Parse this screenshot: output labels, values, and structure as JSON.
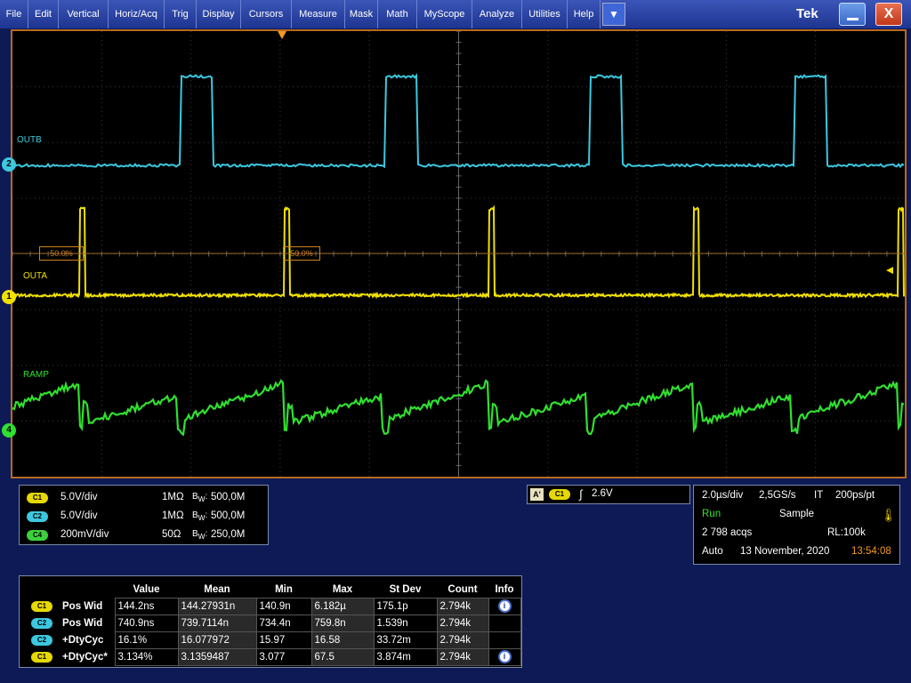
{
  "menubar": {
    "items": [
      "File",
      "Edit",
      "Vertical",
      "Horiz/Acq",
      "Trig",
      "Display",
      "Cursors",
      "Measure",
      "Mask",
      "Math",
      "MyScope",
      "Analyze",
      "Utilities",
      "Help"
    ],
    "dropdown_glyph": "▼",
    "brand": "Tek",
    "close_glyph": "X"
  },
  "waveforms": {
    "ch2": {
      "label": "OUTB",
      "marker": "2",
      "color": "#3cc8e0"
    },
    "ch1": {
      "label": "OUTA",
      "marker": "1",
      "color": "#f0e000"
    },
    "ch4": {
      "label": "RAMP",
      "marker": "4",
      "color": "#30e030"
    },
    "cursor_left_label": "50.0%",
    "cursor_right_label": "50.0%"
  },
  "channels": [
    {
      "tag": "C1",
      "scale": "5.0V/div",
      "impedance": "1MΩ",
      "bw": "500,0M",
      "color": "c1"
    },
    {
      "tag": "C2",
      "scale": "5.0V/div",
      "impedance": "1MΩ",
      "bw": "500,0M",
      "color": "c2"
    },
    {
      "tag": "C4",
      "scale": "200mV/div",
      "impedance": "50Ω",
      "bw": "250,0M",
      "color": "c4"
    }
  ],
  "trigger": {
    "mode_tag": "A'",
    "source": "C1",
    "level": "2.6V"
  },
  "acquisition": {
    "timebase": "2.0µs/div",
    "sample_rate": "2,5GS/s",
    "mode_code": "IT",
    "resolution": "200ps/pt",
    "state": "Run",
    "sample_mode": "Sample",
    "acqs": "2 798 acqs",
    "record_length": "RL:100k",
    "trigger_mode": "Auto",
    "date": "13 November, 2020",
    "time": "13:54:08",
    "colors": {
      "run": "#30e030",
      "time": "#f09a20"
    }
  },
  "measurements": {
    "headers": [
      "Value",
      "Mean",
      "Min",
      "Max",
      "St Dev",
      "Count",
      "Info"
    ],
    "rows": [
      {
        "tag": "C1",
        "color": "c1",
        "label": "Pos Wid",
        "value": "144.2ns",
        "mean": "144.27931n",
        "min": "140.9n",
        "max": "6.182µ",
        "stdev": "175.1p",
        "count": "2.794k",
        "info": true
      },
      {
        "tag": "C2",
        "color": "c2",
        "label": "Pos Wid",
        "value": "740.9ns",
        "mean": "739.7114n",
        "min": "734.4n",
        "max": "759.8n",
        "stdev": "1.539n",
        "count": "2.794k",
        "info": false
      },
      {
        "tag": "C2",
        "color": "c2",
        "label": "+DtyCyc",
        "value": "16.1%",
        "mean": "16.077972",
        "min": "15.97",
        "max": "16.58",
        "stdev": "33.72m",
        "count": "2.794k",
        "info": false
      },
      {
        "tag": "C1",
        "color": "c1",
        "label": "+DtyCyc*",
        "value": "3.134%",
        "mean": "3.1359487",
        "min": "3.077",
        "max": "67.5",
        "stdev": "3.874m",
        "count": "2.794k",
        "info": true
      }
    ]
  }
}
